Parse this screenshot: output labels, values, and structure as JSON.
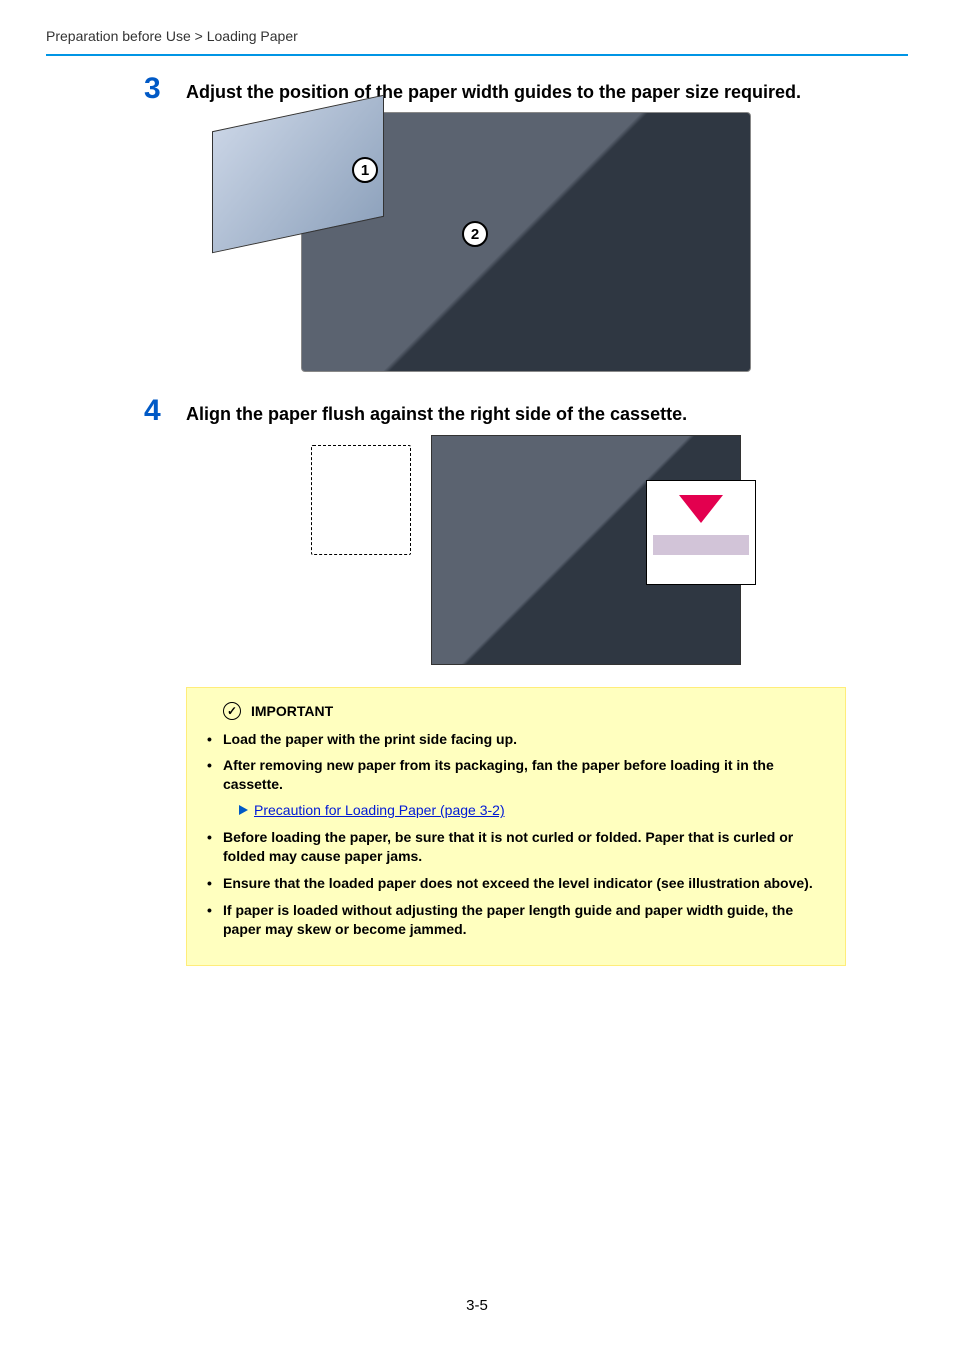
{
  "breadcrumb": "Preparation before Use > Loading Paper",
  "steps": {
    "s3": {
      "num": "3",
      "title": "Adjust the position of the paper width guides to the paper size required.",
      "callout1": "1",
      "callout2": "2"
    },
    "s4": {
      "num": "4",
      "title": "Align the paper flush against the right side of the cassette."
    }
  },
  "important": {
    "label": "IMPORTANT",
    "items": {
      "i1": "Load the paper with the print side facing up.",
      "i2": "After removing new paper from its packaging, fan the paper before loading it in the cassette.",
      "i3": "Before loading the paper, be sure that it is not curled or folded. Paper that is curled or folded may cause paper jams.",
      "i4": "Ensure that the loaded paper does not exceed the level indicator (see illustration above).",
      "i5": "If paper is loaded without adjusting the paper length guide and paper width guide, the paper may skew or become jammed."
    },
    "link": "Precaution for Loading Paper (page 3-2)"
  },
  "page_number": "3-5"
}
